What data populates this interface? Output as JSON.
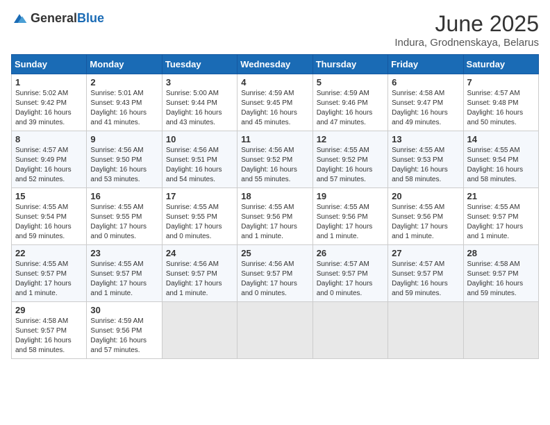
{
  "header": {
    "logo": {
      "general": "General",
      "blue": "Blue"
    },
    "title": "June 2025",
    "location": "Indura, Grodnenskaya, Belarus"
  },
  "calendar": {
    "days_of_week": [
      "Sunday",
      "Monday",
      "Tuesday",
      "Wednesday",
      "Thursday",
      "Friday",
      "Saturday"
    ],
    "weeks": [
      [
        null,
        {
          "day": "1",
          "sunrise": "5:02 AM",
          "sunset": "9:42 PM",
          "daylight": "16 hours and 39 minutes."
        },
        {
          "day": "2",
          "sunrise": "5:01 AM",
          "sunset": "9:43 PM",
          "daylight": "16 hours and 41 minutes."
        },
        {
          "day": "3",
          "sunrise": "5:00 AM",
          "sunset": "9:44 PM",
          "daylight": "16 hours and 43 minutes."
        },
        {
          "day": "4",
          "sunrise": "4:59 AM",
          "sunset": "9:45 PM",
          "daylight": "16 hours and 45 minutes."
        },
        {
          "day": "5",
          "sunrise": "4:59 AM",
          "sunset": "9:46 PM",
          "daylight": "16 hours and 47 minutes."
        },
        {
          "day": "6",
          "sunrise": "4:58 AM",
          "sunset": "9:47 PM",
          "daylight": "16 hours and 49 minutes."
        },
        {
          "day": "7",
          "sunrise": "4:57 AM",
          "sunset": "9:48 PM",
          "daylight": "16 hours and 50 minutes."
        }
      ],
      [
        {
          "day": "8",
          "sunrise": "4:57 AM",
          "sunset": "9:49 PM",
          "daylight": "16 hours and 52 minutes."
        },
        {
          "day": "9",
          "sunrise": "4:56 AM",
          "sunset": "9:50 PM",
          "daylight": "16 hours and 53 minutes."
        },
        {
          "day": "10",
          "sunrise": "4:56 AM",
          "sunset": "9:51 PM",
          "daylight": "16 hours and 54 minutes."
        },
        {
          "day": "11",
          "sunrise": "4:56 AM",
          "sunset": "9:52 PM",
          "daylight": "16 hours and 55 minutes."
        },
        {
          "day": "12",
          "sunrise": "4:55 AM",
          "sunset": "9:52 PM",
          "daylight": "16 hours and 57 minutes."
        },
        {
          "day": "13",
          "sunrise": "4:55 AM",
          "sunset": "9:53 PM",
          "daylight": "16 hours and 58 minutes."
        },
        {
          "day": "14",
          "sunrise": "4:55 AM",
          "sunset": "9:54 PM",
          "daylight": "16 hours and 58 minutes."
        }
      ],
      [
        {
          "day": "15",
          "sunrise": "4:55 AM",
          "sunset": "9:54 PM",
          "daylight": "16 hours and 59 minutes."
        },
        {
          "day": "16",
          "sunrise": "4:55 AM",
          "sunset": "9:55 PM",
          "daylight": "17 hours and 0 minutes."
        },
        {
          "day": "17",
          "sunrise": "4:55 AM",
          "sunset": "9:55 PM",
          "daylight": "17 hours and 0 minutes."
        },
        {
          "day": "18",
          "sunrise": "4:55 AM",
          "sunset": "9:56 PM",
          "daylight": "17 hours and 1 minute."
        },
        {
          "day": "19",
          "sunrise": "4:55 AM",
          "sunset": "9:56 PM",
          "daylight": "17 hours and 1 minute."
        },
        {
          "day": "20",
          "sunrise": "4:55 AM",
          "sunset": "9:56 PM",
          "daylight": "17 hours and 1 minute."
        },
        {
          "day": "21",
          "sunrise": "4:55 AM",
          "sunset": "9:57 PM",
          "daylight": "17 hours and 1 minute."
        }
      ],
      [
        {
          "day": "22",
          "sunrise": "4:55 AM",
          "sunset": "9:57 PM",
          "daylight": "17 hours and 1 minute."
        },
        {
          "day": "23",
          "sunrise": "4:55 AM",
          "sunset": "9:57 PM",
          "daylight": "17 hours and 1 minute."
        },
        {
          "day": "24",
          "sunrise": "4:56 AM",
          "sunset": "9:57 PM",
          "daylight": "17 hours and 1 minute."
        },
        {
          "day": "25",
          "sunrise": "4:56 AM",
          "sunset": "9:57 PM",
          "daylight": "17 hours and 0 minutes."
        },
        {
          "day": "26",
          "sunrise": "4:57 AM",
          "sunset": "9:57 PM",
          "daylight": "17 hours and 0 minutes."
        },
        {
          "day": "27",
          "sunrise": "4:57 AM",
          "sunset": "9:57 PM",
          "daylight": "16 hours and 59 minutes."
        },
        {
          "day": "28",
          "sunrise": "4:58 AM",
          "sunset": "9:57 PM",
          "daylight": "16 hours and 59 minutes."
        }
      ],
      [
        {
          "day": "29",
          "sunrise": "4:58 AM",
          "sunset": "9:57 PM",
          "daylight": "16 hours and 58 minutes."
        },
        {
          "day": "30",
          "sunrise": "4:59 AM",
          "sunset": "9:56 PM",
          "daylight": "16 hours and 57 minutes."
        },
        null,
        null,
        null,
        null,
        null
      ]
    ]
  }
}
